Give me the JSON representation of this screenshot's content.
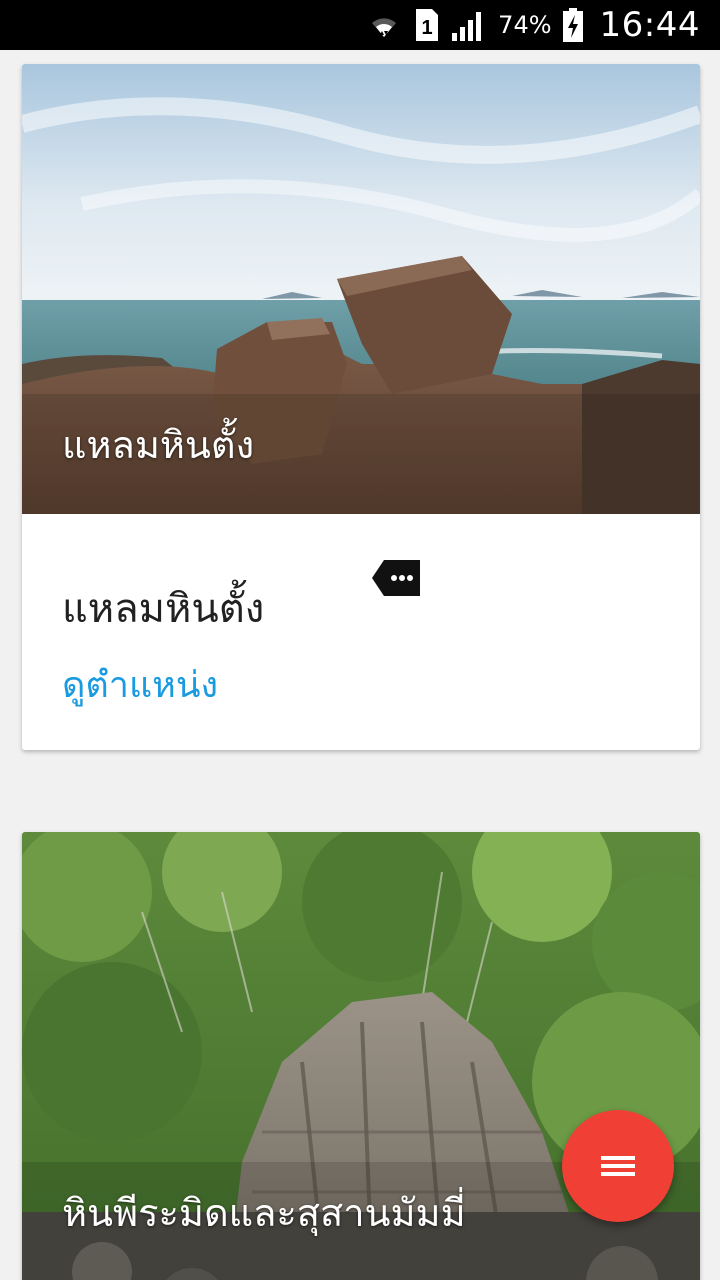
{
  "status_bar": {
    "battery_percent": "74%",
    "sim_slot": "1",
    "time": "16:44",
    "icons": [
      "wifi-icon",
      "sim-icon",
      "signal-icon",
      "battery-charging-icon"
    ]
  },
  "cards": [
    {
      "image_caption": "แหลมหินตั้ง",
      "title": "แหลมหินตั้ง",
      "link_label": "ดูตำแหน่ง",
      "more_icon": "more-tag-icon"
    },
    {
      "image_caption": "หินพีระมิดและสุสานมัมมี่"
    }
  ],
  "fab": {
    "icon": "menu-icon"
  },
  "colors": {
    "accent_link": "#1a9ae0",
    "fab": "#f04035",
    "status_bar": "#000000",
    "background": "#f1f1f1"
  }
}
